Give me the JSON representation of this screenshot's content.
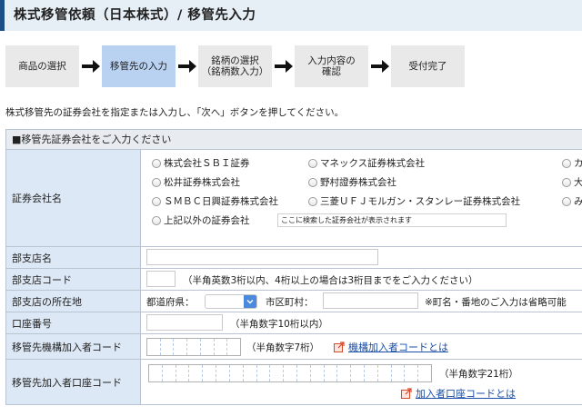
{
  "page": {
    "title": "株式移管依頼（日本株式）/ 移管先入力"
  },
  "steps": [
    {
      "label": "商品の選択"
    },
    {
      "label": "移管先の入力"
    },
    {
      "label": "銘柄の選択\n（銘柄数入力）"
    },
    {
      "label": "入力内容の\n確認"
    },
    {
      "label": "受付完了"
    }
  ],
  "instruction": "株式移管先の証券会社を指定または入力し、「次へ」ボタンを押してください。",
  "form": {
    "header": "■移管先証券会社をご入力ください",
    "broker": {
      "label": "証券会社名",
      "options": [
        "株式会社ＳＢＩ証券",
        "マネックス証券株式会社",
        "カ",
        "松井証券株式会社",
        "野村證券株式会社",
        "大",
        "ＳＭＢＣ日興証券株式会社",
        "三菱ＵＦＪモルガン・スタンレー証券株式会社",
        "み",
        "上記以外の証券会社"
      ],
      "search_hint": "ここに検索した証券会社が表示されます"
    },
    "branch_name": {
      "label": "部支店名",
      "value": ""
    },
    "branch_code": {
      "label": "部支店コード",
      "value": "",
      "note": "（半角英数3桁以内、4桁以上の場合は3桁目までをご入力ください）"
    },
    "branch_location": {
      "label": "部支店の所在地",
      "prefecture_label": "都道府県：",
      "prefecture_value": "",
      "city_label": "市区町村：",
      "city_value": "",
      "note": "※町名・番地のご入力は省略可能"
    },
    "account_number": {
      "label": "口座番号",
      "value": "",
      "note": "（半角数字10桁以内）"
    },
    "institution_code": {
      "label": "移管先機構加入者コード",
      "note": "（半角数字7桁）",
      "link": "機構加入者コードとは",
      "digits": 7
    },
    "account_code": {
      "label": "移管先加入者口座コード",
      "note": "（半角数字21桁）",
      "link": "加入者口座コードとは",
      "digits": 21
    }
  },
  "colors": {
    "accent": "#1c4f86",
    "active_step": "#b9d2f2",
    "label_bg": "#dde8f6",
    "link": "#1a4ea8"
  },
  "icons": {
    "step_arrow": "arrow-right-icon",
    "link": "external-link-icon",
    "dropdown": "chevron-down-icon"
  }
}
